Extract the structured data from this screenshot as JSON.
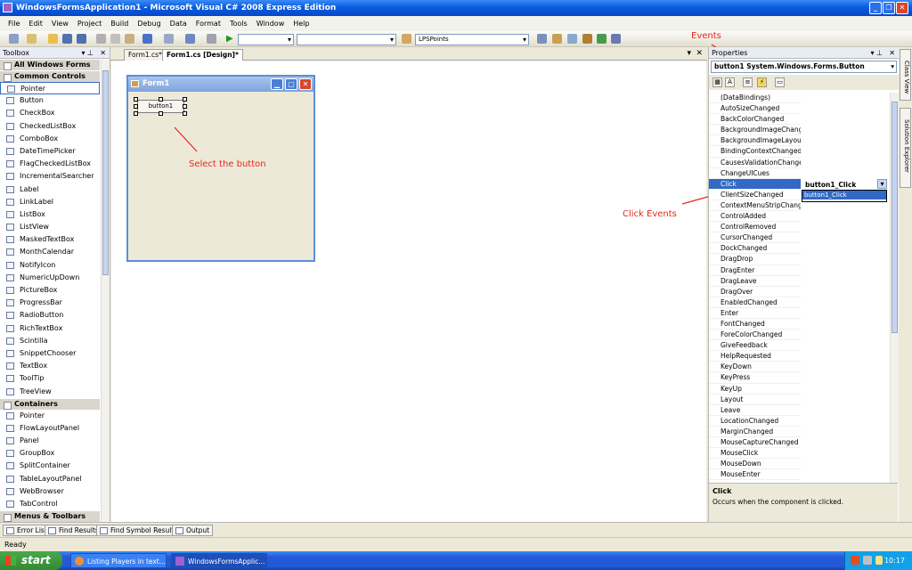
{
  "window": {
    "title": "WindowsFormsApplication1 - Microsoft Visual C# 2008 Express Edition",
    "controls": [
      "_",
      "❐",
      "✕"
    ]
  },
  "menu": [
    "File",
    "Edit",
    "View",
    "Project",
    "Build",
    "Debug",
    "Data",
    "Format",
    "Tools",
    "Window",
    "Help"
  ],
  "toolbar": {
    "combo_text": "LPSPoints"
  },
  "toolbox": {
    "title": "Toolbox",
    "categories": [
      {
        "name": "All Windows Forms",
        "items": []
      },
      {
        "name": "Common Controls",
        "items": [
          "Pointer",
          "Button",
          "CheckBox",
          "CheckedListBox",
          "ComboBox",
          "DateTimePicker",
          "FlagCheckedListBox",
          "IncrementalSearcher",
          "Label",
          "LinkLabel",
          "ListBox",
          "ListView",
          "MaskedTextBox",
          "MonthCalendar",
          "NotifyIcon",
          "NumericUpDown",
          "PictureBox",
          "ProgressBar",
          "RadioButton",
          "RichTextBox",
          "Scintilla",
          "SnippetChooser",
          "TextBox",
          "ToolTip",
          "TreeView"
        ]
      },
      {
        "name": "Containers",
        "items": [
          "Pointer",
          "FlowLayoutPanel",
          "Panel",
          "GroupBox",
          "SplitContainer",
          "TableLayoutPanel",
          "WebBrowser",
          "TabControl"
        ]
      },
      {
        "name": "Menus & Toolbars",
        "items": []
      }
    ]
  },
  "doc_tabs": [
    "Form1.cs*",
    "Form1.cs [Design]*"
  ],
  "form": {
    "title": "Form1",
    "button_text": "button1"
  },
  "annotations": {
    "select": "Select the button",
    "click_events": "Click Events",
    "events": "Events"
  },
  "properties": {
    "title": "Properties",
    "object": "button1  System.Windows.Forms.Button",
    "events": [
      "(DataBindings)",
      "AutoSizeChanged",
      "BackColorChanged",
      "BackgroundImageChanged",
      "BackgroundImageLayoutChanged",
      "BindingContextChanged",
      "CausesValidationChanged",
      "ChangeUICues",
      "Click",
      "ClientSizeChanged",
      "ContextMenuStripChanged",
      "ControlAdded",
      "ControlRemoved",
      "CursorChanged",
      "DockChanged",
      "DragDrop",
      "DragEnter",
      "DragLeave",
      "DragOver",
      "EnabledChanged",
      "Enter",
      "FontChanged",
      "ForeColorChanged",
      "GiveFeedback",
      "HelpRequested",
      "KeyDown",
      "KeyPress",
      "KeyUp",
      "Layout",
      "Leave",
      "LocationChanged",
      "MarginChanged",
      "MouseCaptureChanged",
      "MouseClick",
      "MouseDown",
      "MouseEnter"
    ],
    "click_value": "button1_Click",
    "dropdown_option": "button1_Click",
    "desc_title": "Click",
    "desc_text": "Occurs when the component is clicked."
  },
  "side_tabs": [
    "Class View",
    "Solution Explorer"
  ],
  "bottom_tabs": [
    "Error List",
    "Find Results",
    "Find Symbol Results",
    "Output"
  ],
  "status": "Ready",
  "taskbar": {
    "start": "start",
    "tasks": [
      "Listing Players in text...",
      "WindowsFormsApplic..."
    ],
    "clock": "10:17"
  }
}
